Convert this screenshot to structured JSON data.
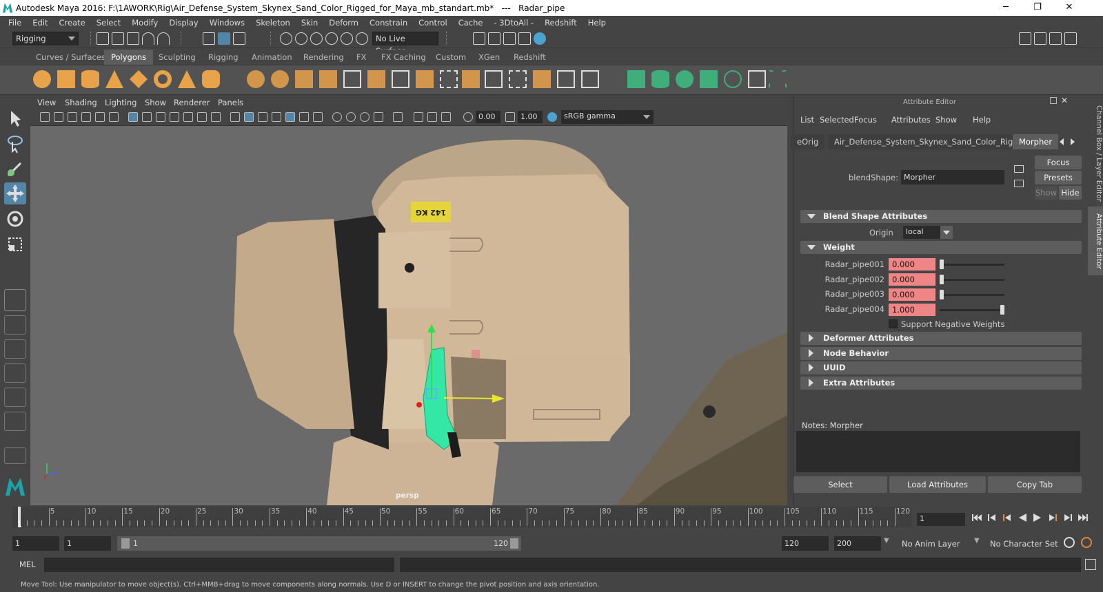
{
  "window": {
    "title": "Autodesk Maya 2016: F:\\1AWORK\\Rig\\Air_Defense_System_Skynex_Sand_Color_Rigged_for_Maya_mb_standart.mb*   ---   Radar_pipe",
    "minimize": "─",
    "maximize": "❐",
    "close": "✕"
  },
  "menubar": [
    "File",
    "Edit",
    "Create",
    "Select",
    "Modify",
    "Display",
    "Windows",
    "Skeleton",
    "Skin",
    "Deform",
    "Constrain",
    "Control",
    "Cache",
    "- 3DtoAll -",
    "Redshift",
    "Help"
  ],
  "statusline": {
    "mode": "Rigging",
    "live_surface": "No Live Surface"
  },
  "shelf_tabs": [
    "Curves / Surfaces",
    "Polygons",
    "Sculpting",
    "Rigging",
    "Animation",
    "Rendering",
    "FX",
    "FX Caching",
    "Custom",
    "XGen",
    "Redshift"
  ],
  "shelf_active": "Polygons",
  "viewport": {
    "menu": [
      "View",
      "Shading",
      "Lighting",
      "Show",
      "Renderer",
      "Panels"
    ],
    "exposure": "0.00",
    "gamma": "1.00",
    "color_space": "sRGB gamma",
    "camera": "persp",
    "decal": "142 KG"
  },
  "attribute_editor": {
    "title": "Attribute Editor",
    "menu": [
      "List",
      "Selected",
      "Focus",
      "Attributes",
      "Show",
      "Help"
    ],
    "tabs": [
      "eOrig",
      "Air_Defense_System_Skynex_Sand_Color_Rigged",
      "Morpher"
    ],
    "active_tab": "Morpher",
    "blendshape_label": "blendShape:",
    "blendshape_value": "Morpher",
    "focus_btn": "Focus",
    "presets_btn": "Presets",
    "show_btn": "Show",
    "hide_btn": "Hide",
    "sections": {
      "blend": "Blend Shape Attributes",
      "origin_label": "Origin",
      "origin_value": "local",
      "weight": "Weight",
      "support_neg": "Support Negative Weights",
      "deformer": "Deformer Attributes",
      "node": "Node Behavior",
      "uuid": "UUID",
      "extra": "Extra Attributes"
    },
    "weights": [
      {
        "name": "Radar_pipe001",
        "value": "0.000",
        "level": 0.0
      },
      {
        "name": "Radar_pipe002",
        "value": "0.000",
        "level": 0.0
      },
      {
        "name": "Radar_pipe003",
        "value": "0.000",
        "level": 0.0
      },
      {
        "name": "Radar_pipe004",
        "value": "1.000",
        "level": 1.0
      }
    ],
    "notes_label": "Notes:  Morpher",
    "bottom_buttons": [
      "Select",
      "Load Attributes",
      "Copy Tab"
    ],
    "side_tabs": [
      "Channel Box / Layer Editor",
      "Attribute Editor"
    ]
  },
  "timeline": {
    "ticks": [
      "5",
      "10",
      "15",
      "20",
      "25",
      "30",
      "35",
      "40",
      "45",
      "50",
      "55",
      "60",
      "65",
      "70",
      "75",
      "80",
      "85",
      "90",
      "95",
      "100",
      "105",
      "110",
      "115",
      "120"
    ],
    "current_frame_marker": "1",
    "current_frame": "1"
  },
  "range": {
    "start": "1",
    "playback_start": "1",
    "slider_start": "1",
    "slider_end": "120",
    "playback_end": "120",
    "end": "200",
    "anim_layer": "No Anim Layer",
    "char_set": "No Character Set"
  },
  "cmdline": {
    "label": "MEL"
  },
  "help_line": "Move Tool: Use manipulator to move object(s). Ctrl+MMB+drag to move components along normals. Use D or INSERT to change the pivot position and axis orientation."
}
